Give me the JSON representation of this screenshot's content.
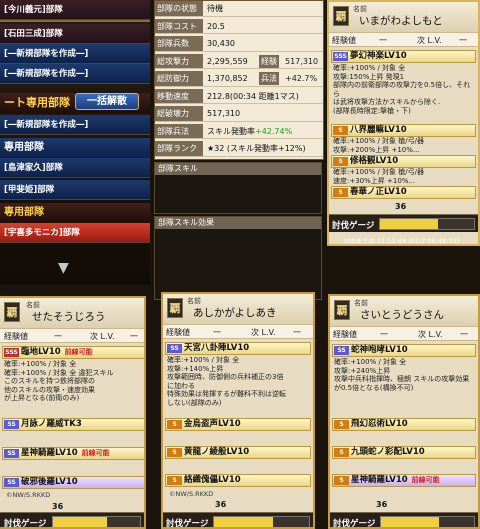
{
  "sidebar": {
    "items": [
      {
        "label": "[今川義元]部隊",
        "style": "dark"
      },
      {
        "label": "[石田三成]部隊",
        "style": "dark"
      },
      {
        "label": "[―新規部隊を作成―]",
        "style": "blue"
      },
      {
        "label": "[―新規部隊を作成―]",
        "style": "blue"
      },
      {
        "label": "[―新規部隊を作成―]",
        "style": "blue"
      },
      {
        "label": "[島津家久]部隊",
        "style": "blue"
      },
      {
        "label": "[甲斐姫]部隊",
        "style": "blue"
      },
      {
        "label": "[宇喜多モニカ]部隊",
        "style": "red"
      }
    ],
    "heading_special": "ート専用部隊",
    "heading_special2": "専用部隊",
    "heading_blue": "専用部隊",
    "dismiss_button": "一括解散",
    "arrow": "▼"
  },
  "status": {
    "rows": [
      {
        "label": "部隊の状態",
        "value": "待機"
      },
      {
        "label": "部隊コスト",
        "value": "20.5"
      },
      {
        "label": "部隊兵数",
        "value": "30,430"
      },
      {
        "label": "総攻撃力",
        "value": "2,295,559",
        "label2": "経験",
        "value2": "517,310"
      },
      {
        "label": "総防御力",
        "value": "1,370,852",
        "label2": "兵法",
        "value2": "+42.7%"
      },
      {
        "label": "移動速度",
        "value": "212.8(00:34 距離1マス)"
      },
      {
        "label": "総破壊力",
        "value": "517,310"
      },
      {
        "label": "部隊兵法",
        "value": "スキル発動率",
        "value_green": "+42.74%"
      },
      {
        "label": "部隊ランク",
        "value": "★32 (スキル発動率+12%)"
      }
    ],
    "skill_title": "部隊スキル",
    "skill_effect_title": "部隊スキル効果"
  },
  "cards": [
    {
      "name_label": "名前",
      "name": "いまがわよしもと",
      "face": "覇",
      "exp_label": "経験値",
      "exp_value": "一",
      "next_label": "次 L.V.",
      "next_value": "一",
      "skills": [
        {
          "rank": "SSS",
          "name": "夢幻神楽LV10",
          "tag": ""
        },
        {
          "rank": "S",
          "name": "八界麗嘛LV10",
          "tag": ""
        },
        {
          "rank": "S",
          "name": "修格観LV10",
          "tag": ""
        },
        {
          "rank": "S",
          "name": "春華ノ正LV10",
          "tag": ""
        }
      ],
      "desc": [
        "確率:+100% / 対象 全",
        "攻撃:150%上昇 発現1",
        "部隊内の前衛部隊の攻撃力を0.5倍し、それら",
        "は武将攻撃方法かスキルから除く.",
        "(部隊長時限定:撃槍・下)"
      ],
      "desc2": [
        "確率:+100% / 対象 槍/弓/器",
        "攻撃:+200%上昇 +10%..."
      ],
      "desc3": [
        "確率:+100% / 対象 槍/弓/器",
        "速度:+30%上昇 +10%..."
      ],
      "gauge_label": "討伐ゲージ",
      "gauge_num": "36",
      "gauge_fill": 0.62,
      "footnote": "300までの 11:52:48 (01/7 06:48:32)",
      "copyright": "©NW/S.RKKD"
    },
    {
      "name_label": "名前",
      "name": "せたそうじろう",
      "face": "覇",
      "exp_label": "経験値",
      "exp_value": "一",
      "next_label": "次 L.V.",
      "next_value": "一",
      "skills": [
        {
          "rank": "SSS",
          "name": "臨地LV10",
          "tag": "前線可能"
        },
        {
          "rank": "SS",
          "name": "月詠ノ羅威TK3",
          "tag": ""
        },
        {
          "rank": "SS",
          "name": "星神騎羅LV10",
          "tag": "前線可能"
        },
        {
          "rank": "SS",
          "name": "破邪後羅LV10",
          "tag": ""
        }
      ],
      "desc": [
        "確率:+100% / 対象 全",
        "確率:+100% / 対象 全 違犯スキル",
        "このスキルを持つ鉄将部隊の",
        "他のスキルの攻撃・速度効果",
        "が上昇となる(前衛のみ)"
      ],
      "gauge_label": "討伐ゲージ",
      "gauge_num": "36",
      "gauge_fill": 0.62,
      "copyright": "©NW/S.RKKD"
    },
    {
      "name_label": "名前",
      "name": "あしかがよしあき",
      "face": "覇",
      "exp_label": "経験値",
      "exp_value": "一",
      "next_label": "次 L.V.",
      "next_value": "一",
      "skills": [
        {
          "rank": "SS",
          "name": "天宮八卦陣LV10",
          "tag": ""
        },
        {
          "rank": "S",
          "name": "金烏盗声LV10",
          "tag": ""
        },
        {
          "rank": "S",
          "name": "黄龍ノ綾般LV10",
          "tag": ""
        },
        {
          "rank": "S",
          "name": "絡織傀儡LV10",
          "tag": ""
        }
      ],
      "desc": [
        "確率:+100% / 対象 全",
        "攻撃:+140%上昇",
        "攻撃範囲時、防御側の兵科補正の3倍",
        "に加わる",
        "特殊効果は発揮するが難科不利は逆転",
        "しない(部隊のみ)"
      ],
      "gauge_label": "討伐ゲージ",
      "gauge_num": "36",
      "gauge_fill": 0.62,
      "footnote": "©NW/S.RKKD"
    },
    {
      "name_label": "名前",
      "name": "さいとうどうさん",
      "face": "覇",
      "exp_label": "経験値",
      "exp_value": "一",
      "next_label": "次 L.V.",
      "next_value": "一",
      "skills": [
        {
          "rank": "SS",
          "name": "蛇神咆哮LV10",
          "tag": ""
        },
        {
          "rank": "S",
          "name": "飛幻忍術LV10",
          "tag": ""
        },
        {
          "rank": "S",
          "name": "九頭蛇ノ彩配LV10",
          "tag": ""
        },
        {
          "rank": "S",
          "name": "星神騎羅LV10",
          "tag": "前線可能"
        }
      ],
      "desc": [
        "確率:+100% / 対象 全",
        "攻撃:+240%上昇",
        "攻撃中兵科指揮時、極朗 スキルの攻撃効果",
        "が0.5倍となる(構換不可)"
      ],
      "gauge_label": "討伐ゲージ",
      "gauge_num": "36",
      "gauge_fill": 0.62
    }
  ]
}
